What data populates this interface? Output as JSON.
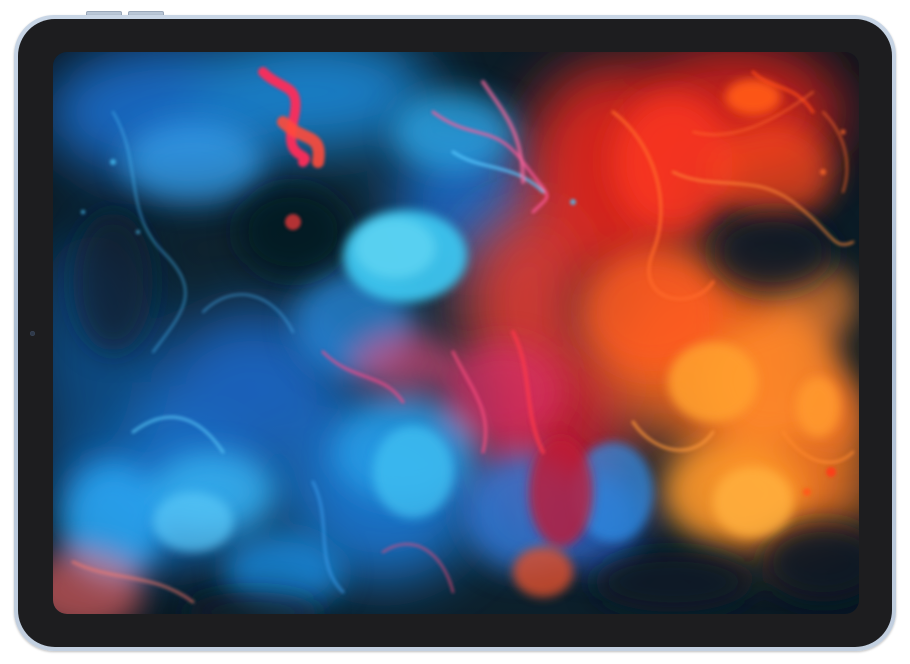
{
  "device": {
    "shell_color": "#b4c4d8",
    "bezel_color": "#1d1d1f"
  },
  "wallpaper": {
    "palette": {
      "background": "#0d1f2a",
      "cyan": "#18b4f0",
      "blue": "#1e74d8",
      "orange": "#ff6a1a",
      "red": "#f02a1e",
      "pink": "#ff3a78",
      "amber": "#ff9a2a"
    }
  }
}
